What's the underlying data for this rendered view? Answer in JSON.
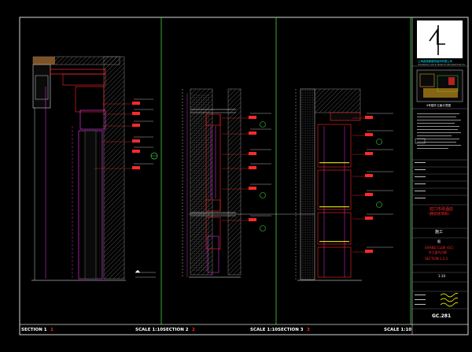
{
  "sheet": {
    "sections": [
      {
        "label": "SECTION 1",
        "ref": "1",
        "scale": "SCALE 1:10"
      },
      {
        "label": "SECTION 2",
        "ref": "2",
        "scale": "SCALE 1:10"
      },
      {
        "label": "SECTION 3",
        "ref": "3",
        "scale": "SCALE 1:10"
      }
    ]
  },
  "title_block": {
    "logo_glyph": "4",
    "company_line1": "上海金螳螂建筑装饰有限公司",
    "company_line2": "SHANGHAI GOLD MANTIS DECORATION CO.",
    "keyplan_caption": "4号楼外立面示意图",
    "stage": "施工",
    "discipline": "图",
    "project_cn": "虹口市政酒店",
    "project_cn2": "(精装修项目)",
    "project_en": "GRAND CLUB (GC)",
    "project_en2": "外立面节点图",
    "section_ref": "SECTION 1,2,3",
    "scale_value": "1:10",
    "drawing_no": "GC.281"
  }
}
